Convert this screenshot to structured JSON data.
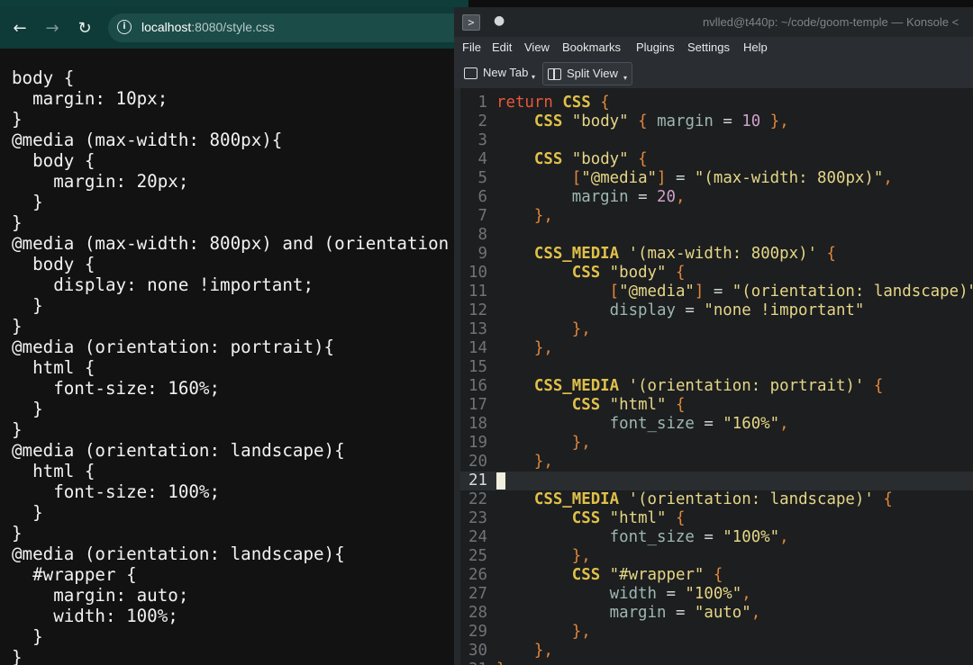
{
  "browser": {
    "url_host": "localhost",
    "url_path": ":8080/style.css",
    "css_lines": [
      "body {",
      "  margin: 10px;",
      "}",
      "@media (max-width: 800px){",
      "  body {",
      "    margin: 20px;",
      "  }",
      "}",
      "@media (max-width: 800px) and (orientation",
      "  body {",
      "    display: none !important;",
      "  }",
      "}",
      "@media (orientation: portrait){",
      "  html {",
      "    font-size: 160%;",
      "  }",
      "}",
      "@media (orientation: landscape){",
      "  html {",
      "    font-size: 100%;",
      "  }",
      "}",
      "@media (orientation: landscape){",
      "  #wrapper {",
      "    margin: auto;",
      "    width: 100%;",
      "  }",
      "}"
    ]
  },
  "konsole": {
    "title": "nvlled@t440p: ~/code/goom-temple — Konsole <",
    "pin_icon": "●",
    "menu": [
      "File",
      "Edit",
      "View",
      "Bookmarks",
      "Plugins",
      "Settings",
      "Help"
    ],
    "toolbar": {
      "new_tab": "New Tab",
      "split_view": "Split View"
    },
    "current_line": 21,
    "lines": [
      {
        "n": "1",
        "parts": [
          {
            "c": "kw",
            "t": "return"
          },
          {
            "c": "op",
            "t": " "
          },
          {
            "c": "fn",
            "t": "CSS"
          },
          {
            "c": "op",
            "t": " "
          },
          {
            "c": "pu",
            "t": "{"
          }
        ]
      },
      {
        "n": "2",
        "parts": [
          {
            "c": "op",
            "t": "    "
          },
          {
            "c": "fn",
            "t": "CSS"
          },
          {
            "c": "op",
            "t": " "
          },
          {
            "c": "str",
            "t": "\"body\""
          },
          {
            "c": "op",
            "t": " "
          },
          {
            "c": "pu",
            "t": "{"
          },
          {
            "c": "op",
            "t": " "
          },
          {
            "c": "id",
            "t": "margin"
          },
          {
            "c": "op",
            "t": " = "
          },
          {
            "c": "num",
            "t": "10"
          },
          {
            "c": "op",
            "t": " "
          },
          {
            "c": "pu",
            "t": "},"
          }
        ]
      },
      {
        "n": "3",
        "parts": []
      },
      {
        "n": "4",
        "parts": [
          {
            "c": "op",
            "t": "    "
          },
          {
            "c": "fn",
            "t": "CSS"
          },
          {
            "c": "op",
            "t": " "
          },
          {
            "c": "str",
            "t": "\"body\""
          },
          {
            "c": "op",
            "t": " "
          },
          {
            "c": "pu",
            "t": "{"
          }
        ]
      },
      {
        "n": "5",
        "parts": [
          {
            "c": "op",
            "t": "        "
          },
          {
            "c": "pu",
            "t": "["
          },
          {
            "c": "str",
            "t": "\"@media\""
          },
          {
            "c": "pu",
            "t": "]"
          },
          {
            "c": "op",
            "t": " = "
          },
          {
            "c": "str",
            "t": "\"(max-width: 800px)\""
          },
          {
            "c": "pu",
            "t": ","
          }
        ]
      },
      {
        "n": "6",
        "parts": [
          {
            "c": "op",
            "t": "        "
          },
          {
            "c": "id",
            "t": "margin"
          },
          {
            "c": "op",
            "t": " = "
          },
          {
            "c": "num",
            "t": "20"
          },
          {
            "c": "pu",
            "t": ","
          }
        ]
      },
      {
        "n": "7",
        "parts": [
          {
            "c": "op",
            "t": "    "
          },
          {
            "c": "pu",
            "t": "},"
          }
        ]
      },
      {
        "n": "8",
        "parts": []
      },
      {
        "n": "9",
        "parts": [
          {
            "c": "op",
            "t": "    "
          },
          {
            "c": "fn",
            "t": "CSS_MEDIA"
          },
          {
            "c": "op",
            "t": " "
          },
          {
            "c": "str",
            "t": "'(max-width: 800px)'"
          },
          {
            "c": "op",
            "t": " "
          },
          {
            "c": "pu",
            "t": "{"
          }
        ]
      },
      {
        "n": "10",
        "parts": [
          {
            "c": "op",
            "t": "        "
          },
          {
            "c": "fn",
            "t": "CSS"
          },
          {
            "c": "op",
            "t": " "
          },
          {
            "c": "str",
            "t": "\"body\""
          },
          {
            "c": "op",
            "t": " "
          },
          {
            "c": "pu",
            "t": "{"
          }
        ]
      },
      {
        "n": "11",
        "parts": [
          {
            "c": "op",
            "t": "            "
          },
          {
            "c": "pu",
            "t": "["
          },
          {
            "c": "str",
            "t": "\"@media\""
          },
          {
            "c": "pu",
            "t": "]"
          },
          {
            "c": "op",
            "t": " = "
          },
          {
            "c": "str",
            "t": "\"(orientation: landscape)\""
          },
          {
            "c": "pu",
            "t": ","
          }
        ]
      },
      {
        "n": "12",
        "parts": [
          {
            "c": "op",
            "t": "            "
          },
          {
            "c": "id",
            "t": "display"
          },
          {
            "c": "op",
            "t": " = "
          },
          {
            "c": "str",
            "t": "\"none !important\""
          }
        ]
      },
      {
        "n": "13",
        "parts": [
          {
            "c": "op",
            "t": "        "
          },
          {
            "c": "pu",
            "t": "},"
          }
        ]
      },
      {
        "n": "14",
        "parts": [
          {
            "c": "op",
            "t": "    "
          },
          {
            "c": "pu",
            "t": "},"
          }
        ]
      },
      {
        "n": "15",
        "parts": []
      },
      {
        "n": "16",
        "parts": [
          {
            "c": "op",
            "t": "    "
          },
          {
            "c": "fn",
            "t": "CSS_MEDIA"
          },
          {
            "c": "op",
            "t": " "
          },
          {
            "c": "str",
            "t": "'(orientation: portrait)'"
          },
          {
            "c": "op",
            "t": " "
          },
          {
            "c": "pu",
            "t": "{"
          }
        ]
      },
      {
        "n": "17",
        "parts": [
          {
            "c": "op",
            "t": "        "
          },
          {
            "c": "fn",
            "t": "CSS"
          },
          {
            "c": "op",
            "t": " "
          },
          {
            "c": "str",
            "t": "\"html\""
          },
          {
            "c": "op",
            "t": " "
          },
          {
            "c": "pu",
            "t": "{"
          }
        ]
      },
      {
        "n": "18",
        "parts": [
          {
            "c": "op",
            "t": "            "
          },
          {
            "c": "id",
            "t": "font_size"
          },
          {
            "c": "op",
            "t": " = "
          },
          {
            "c": "str",
            "t": "\"160%\""
          },
          {
            "c": "pu",
            "t": ","
          }
        ]
      },
      {
        "n": "19",
        "parts": [
          {
            "c": "op",
            "t": "        "
          },
          {
            "c": "pu",
            "t": "},"
          }
        ]
      },
      {
        "n": "20",
        "parts": [
          {
            "c": "op",
            "t": "    "
          },
          {
            "c": "pu",
            "t": "},"
          }
        ]
      },
      {
        "n": "21",
        "parts": []
      },
      {
        "n": "22",
        "parts": [
          {
            "c": "op",
            "t": "    "
          },
          {
            "c": "fn",
            "t": "CSS_MEDIA"
          },
          {
            "c": "op",
            "t": " "
          },
          {
            "c": "str",
            "t": "'(orientation: landscape)'"
          },
          {
            "c": "op",
            "t": " "
          },
          {
            "c": "pu",
            "t": "{"
          }
        ]
      },
      {
        "n": "23",
        "parts": [
          {
            "c": "op",
            "t": "        "
          },
          {
            "c": "fn",
            "t": "CSS"
          },
          {
            "c": "op",
            "t": " "
          },
          {
            "c": "str",
            "t": "\"html\""
          },
          {
            "c": "op",
            "t": " "
          },
          {
            "c": "pu",
            "t": "{"
          }
        ]
      },
      {
        "n": "24",
        "parts": [
          {
            "c": "op",
            "t": "            "
          },
          {
            "c": "id",
            "t": "font_size"
          },
          {
            "c": "op",
            "t": " = "
          },
          {
            "c": "str",
            "t": "\"100%\""
          },
          {
            "c": "pu",
            "t": ","
          }
        ]
      },
      {
        "n": "25",
        "parts": [
          {
            "c": "op",
            "t": "        "
          },
          {
            "c": "pu",
            "t": "},"
          }
        ]
      },
      {
        "n": "26",
        "parts": [
          {
            "c": "op",
            "t": "        "
          },
          {
            "c": "fn",
            "t": "CSS"
          },
          {
            "c": "op",
            "t": " "
          },
          {
            "c": "str",
            "t": "\"#wrapper\""
          },
          {
            "c": "op",
            "t": " "
          },
          {
            "c": "pu",
            "t": "{"
          }
        ]
      },
      {
        "n": "27",
        "parts": [
          {
            "c": "op",
            "t": "            "
          },
          {
            "c": "id",
            "t": "width"
          },
          {
            "c": "op",
            "t": " = "
          },
          {
            "c": "str",
            "t": "\"100%\""
          },
          {
            "c": "pu",
            "t": ","
          }
        ]
      },
      {
        "n": "28",
        "parts": [
          {
            "c": "op",
            "t": "            "
          },
          {
            "c": "id",
            "t": "margin"
          },
          {
            "c": "op",
            "t": " = "
          },
          {
            "c": "str",
            "t": "\"auto\""
          },
          {
            "c": "pu",
            "t": ","
          }
        ]
      },
      {
        "n": "29",
        "parts": [
          {
            "c": "op",
            "t": "        "
          },
          {
            "c": "pu",
            "t": "},"
          }
        ]
      },
      {
        "n": "30",
        "parts": [
          {
            "c": "op",
            "t": "    "
          },
          {
            "c": "pu",
            "t": "},"
          }
        ]
      },
      {
        "n": "31",
        "parts": [
          {
            "c": "pu",
            "t": "}"
          }
        ]
      }
    ]
  },
  "colors": {
    "browser_bar": "#0e3a37",
    "url_pill": "#1b4c48",
    "keyword": "#e9573a",
    "function": "#e0c049",
    "string": "#e6d685",
    "number": "#d0a0c9",
    "identifier": "#9fb7b1",
    "punctuation": "#e28739"
  },
  "icons": {
    "back": "←",
    "forward": "→",
    "reload": "↻",
    "info": "i",
    "konsole_app": ">",
    "caret": "▾"
  }
}
